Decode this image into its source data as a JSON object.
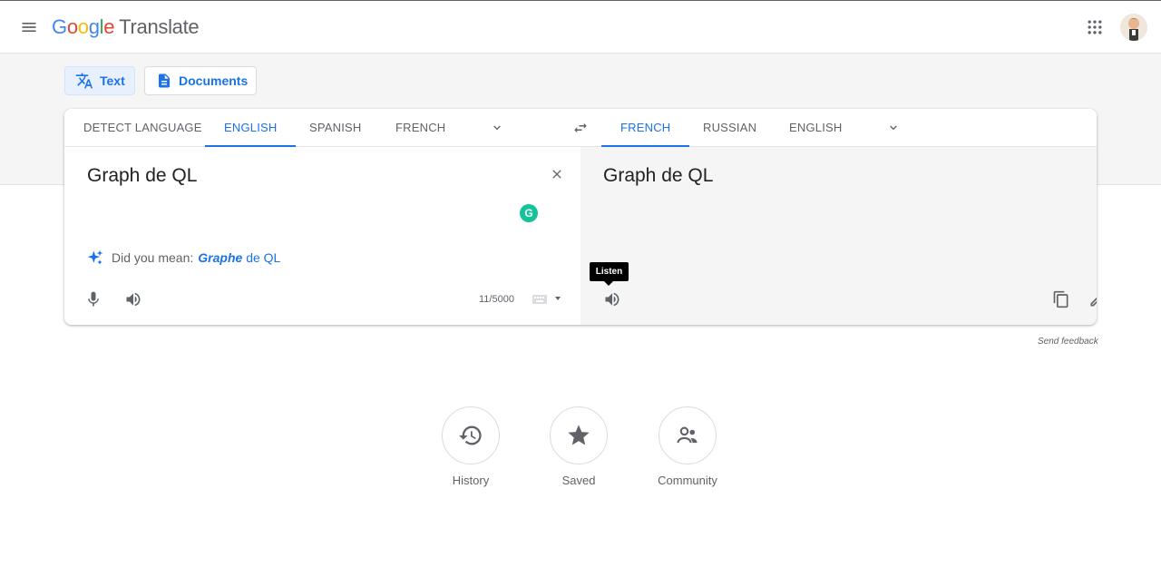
{
  "header": {
    "logo_letters": [
      "G",
      "o",
      "o",
      "g",
      "l",
      "e"
    ],
    "product": "Translate"
  },
  "modes": {
    "text_label": "Text",
    "documents_label": "Documents"
  },
  "source_langs": {
    "detect": "DETECT LANGUAGE",
    "items": [
      "ENGLISH",
      "SPANISH",
      "FRENCH"
    ],
    "active": "ENGLISH"
  },
  "target_langs": {
    "items": [
      "FRENCH",
      "RUSSIAN",
      "ENGLISH"
    ],
    "active": "FRENCH"
  },
  "source": {
    "text": "Graph de QL",
    "grammarly_letter": "G",
    "did_you_mean_label": "Did you mean:",
    "suggestion_bold": "Graphe",
    "suggestion_rest": "de QL",
    "char_count": "11/5000"
  },
  "target": {
    "text": "Graph de QL",
    "tooltip": "Listen"
  },
  "feedback_label": "Send feedback",
  "quick_actions": [
    {
      "label": "History",
      "icon": "history-icon"
    },
    {
      "label": "Saved",
      "icon": "star-icon"
    },
    {
      "label": "Community",
      "icon": "community-icon"
    }
  ],
  "colors": {
    "accent": "#1a73e8",
    "muted": "#5f6368",
    "target_bg": "#f5f5f5",
    "grammarly": "#15c39a"
  }
}
